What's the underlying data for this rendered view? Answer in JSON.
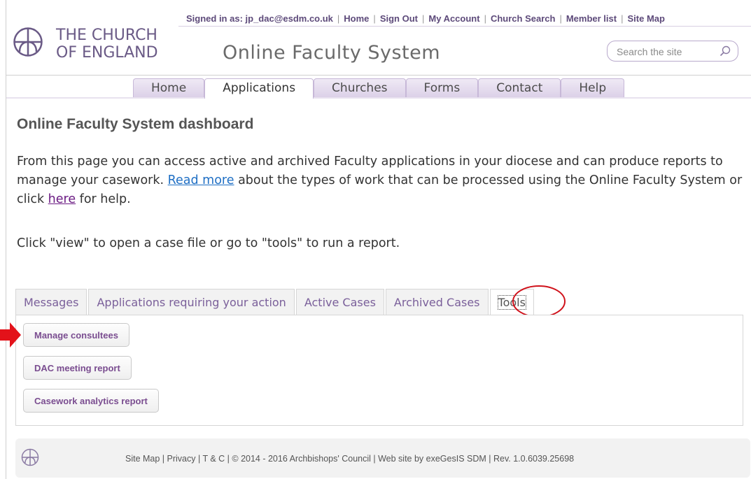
{
  "header": {
    "signed_in": "Signed in as: jp_dac@esdm.co.uk",
    "links": [
      "Home",
      "Sign Out",
      "My Account",
      "Church Search",
      "Member list",
      "Site Map"
    ],
    "logo_line1": "THE CHURCH",
    "logo_line2": "OF ENGLAND",
    "site_title": "Online Faculty System",
    "search_placeholder": "Search the site"
  },
  "nav": {
    "tabs": [
      "Home",
      "Applications",
      "Churches",
      "Forms",
      "Contact",
      "Help"
    ],
    "active": "Applications"
  },
  "main": {
    "page_title": "Online Faculty System dashboard",
    "intro_part1": "From this page you can access active and archived Faculty applications in your diocese and can produce reports to manage your casework. ",
    "read_more": "Read more",
    "intro_part2": " about the types of work that can be processed using the Online Faculty System or click ",
    "here": "here",
    "intro_part3": " for help.",
    "instruction": "Click \"view\" to open a case file or go to \"tools\" to run a report."
  },
  "dashboard": {
    "tabs": [
      "Messages",
      "Applications requiring your action",
      "Active Cases",
      "Archived Cases",
      "Tools"
    ],
    "active": "Tools",
    "buttons": [
      "Manage consultees",
      "DAC meeting report",
      "Casework analytics report"
    ]
  },
  "footer": {
    "text": "Site Map | Privacy | T & C | © 2014 - 2016 Archbishops' Council | Web site by exeGesIS SDM | Rev. 1.0.6039.25698"
  },
  "colors": {
    "brand_purple": "#6a5a86",
    "accent_purple": "#7a4d90",
    "annotation_red": "#d0121b"
  },
  "icons": [
    "church-emblem-icon",
    "search-icon",
    "red-arrow-icon",
    "red-circle-annotation"
  ]
}
